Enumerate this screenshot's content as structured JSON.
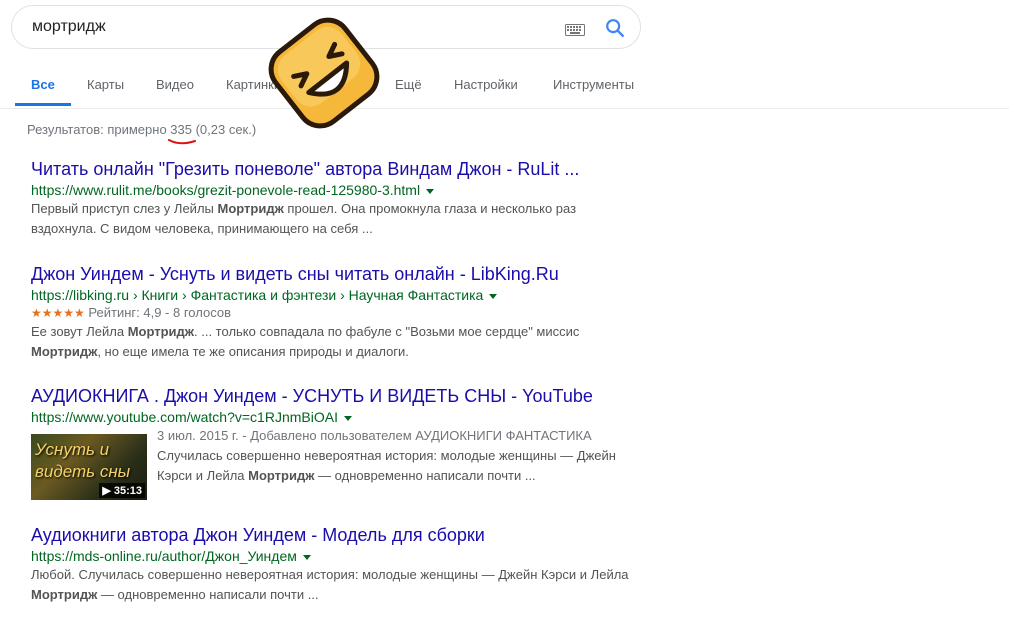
{
  "search": {
    "query": "мортридж"
  },
  "tabs": [
    {
      "label": "Все"
    },
    {
      "label": "Карты"
    },
    {
      "label": "Видео"
    },
    {
      "label": "Картинки"
    },
    {
      "label": "Ещё"
    },
    {
      "label": "Настройки"
    },
    {
      "label": "Инструменты"
    }
  ],
  "stats": "Результатов: примерно 335 (0,23 сек.)",
  "results": [
    {
      "title": "Читать онлайн \"Грезить поневоле\" автора Виндам Джон - RuLit ...",
      "url": "https://www.rulit.me/books/grezit-ponevole-read-125980-3.html",
      "snippet_1a": "Первый приступ слез у Лейлы ",
      "snippet_1b": "Мортридж",
      "snippet_1c": " прошел. Она промокнула глаза и несколько раз",
      "snippet_2": "вздохнула. С видом человека, принимающего на себя ..."
    },
    {
      "title": "Джон Уиндем - Уснуть и видеть сны читать онлайн - LibKing.Ru",
      "url": "https://libking.ru › Книги › Фантастика и фэнтези › Научная Фантастика",
      "stars": "★★★★★",
      "rating": 4.9,
      "rating_text": "Рейтинг: 4,9 - 8 голосов",
      "snippet_1a": "Ее зовут Лейла ",
      "snippet_1b": "Мортридж",
      "snippet_1c": ". ... только совпадала по фабуле с \"Возьми мое сердце\" миссис",
      "snippet_2a": "Мортридж",
      "snippet_2b": ", но еще имела те же описания природы и диалоги."
    },
    {
      "title": "АУДИОКНИГА . Джон Уиндем - УСНУТЬ И ВИДЕТЬ СНЫ - YouTube",
      "url": "https://www.youtube.com/watch?v=c1RJnmBiOAI",
      "thumb_line1": "Уснуть и",
      "thumb_line2": "видеть сны",
      "duration": "▶ 35:13",
      "meta": "3 июл. 2015 г. - Добавлено пользователем АУДИОКНИГИ ФАНТАСТИКА",
      "snippet_1": "Случилась совершенно невероятная история: молодые женщины — Джейн",
      "snippet_2a": "Кэрси и Лейла ",
      "snippet_2b": "Мортридж",
      "snippet_2c": " — одновременно написали почти ..."
    },
    {
      "title": "Аудиокниги автора Джон Уиндем - Модель для сборки",
      "url": "https://mds-online.ru/author/Джон_Уиндем",
      "snippet_1": "Любой. Случилась совершенно невероятная история: молодые женщины — Джейн Кэрси и Лейла",
      "snippet_2a": "Мортридж",
      "snippet_2b": " — одновременно написали почти ..."
    }
  ],
  "colors": {
    "link": "#1a0dab",
    "url": "#006621",
    "accent": "#1a73e8",
    "emoji": "#f5b83a",
    "mark": "#d11"
  }
}
